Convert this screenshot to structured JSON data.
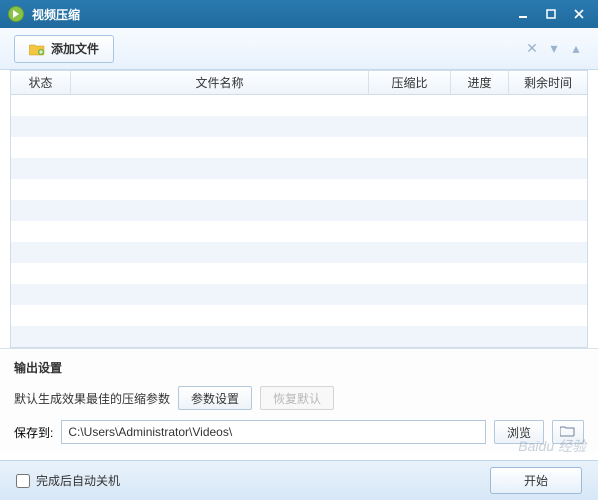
{
  "window": {
    "title": "视频压缩"
  },
  "toolbar": {
    "add_label": "添加文件"
  },
  "table": {
    "headers": {
      "status": "状态",
      "name": "文件名称",
      "ratio": "压缩比",
      "progress": "进度",
      "time": "剩余时间"
    },
    "rows": []
  },
  "output": {
    "section_title": "输出设置",
    "hint": "默认生成效果最佳的压缩参数",
    "params_btn": "参数设置",
    "restore_btn": "恢复默认",
    "save_to_label": "保存到:",
    "path": "C:\\Users\\Administrator\\Videos\\",
    "browse_btn": "浏览"
  },
  "footer": {
    "shutdown_label": "完成后自动关机",
    "shutdown_checked": false,
    "start_btn": "开始"
  },
  "watermark": "Baidu 经验"
}
